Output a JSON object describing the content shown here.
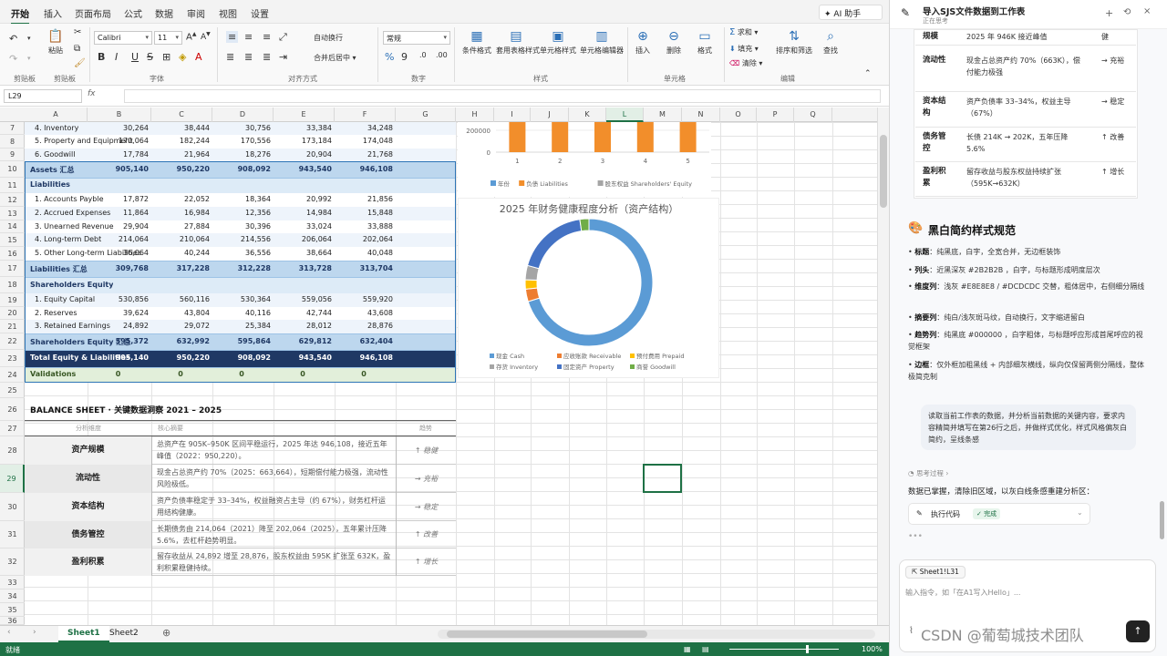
{
  "ribbon": {
    "tabs": [
      "开始",
      "插入",
      "页面布局",
      "公式",
      "数据",
      "审阅",
      "视图",
      "设置"
    ],
    "ai_button": "AI 助手",
    "groups": [
      "剪贴板",
      "字体",
      "对齐方式",
      "数字",
      "样式",
      "单元格",
      "编辑"
    ],
    "clipboard": {
      "paste": "粘贴"
    },
    "font": {
      "name": "Calibri",
      "size": "11"
    },
    "align": {
      "wrap": "自动换行",
      "merge": "合并后居中"
    },
    "number": {
      "format": "常规"
    },
    "style": {
      "cond": "条件格式",
      "table": "套用表格样式",
      "cell_style": "单元格样式",
      "cell_edit": "单元格编辑器"
    },
    "cells": {
      "insert": "插入",
      "delete": "删除",
      "format": "格式"
    },
    "edit": {
      "sum": "求和",
      "fill": "填充",
      "clear": "清除",
      "sort": "排序和筛选",
      "find": "查找"
    }
  },
  "formula_bar": {
    "name_box": "L29",
    "fx": "fx",
    "value": ""
  },
  "columns": [
    "A",
    "B",
    "C",
    "D",
    "E",
    "F",
    "G",
    "H",
    "I",
    "J",
    "K",
    "L",
    "M",
    "N",
    "O",
    "P",
    "Q"
  ],
  "active_column": "L",
  "active_row": 29,
  "rows": [
    {
      "r": 7,
      "label": "4. Inventory",
      "v": [
        "30,264",
        "38,444",
        "30,756",
        "33,384",
        "34,248"
      ],
      "style": "item"
    },
    {
      "r": 8,
      "label": "5. Property and Equipment",
      "v": [
        "170,064",
        "182,244",
        "170,556",
        "173,184",
        "174,048"
      ],
      "style": "item"
    },
    {
      "r": 9,
      "label": "6. Goodwill",
      "v": [
        "17,784",
        "21,964",
        "18,276",
        "20,904",
        "21,768"
      ],
      "style": "item"
    },
    {
      "r": 10,
      "label": "Assets 汇总",
      "v": [
        "905,140",
        "950,220",
        "908,092",
        "943,540",
        "946,108"
      ],
      "style": "subtotal"
    },
    {
      "r": 11,
      "label": "Liabilities",
      "v": [
        "",
        "",
        "",
        "",
        ""
      ],
      "style": "section"
    },
    {
      "r": 12,
      "label": "1. Accounts Payble",
      "v": [
        "17,872",
        "22,052",
        "18,364",
        "20,992",
        "21,856"
      ],
      "style": "item"
    },
    {
      "r": 13,
      "label": "2. Accrued Expenses",
      "v": [
        "11,864",
        "16,984",
        "12,356",
        "14,984",
        "15,848"
      ],
      "style": "item"
    },
    {
      "r": 14,
      "label": "3. Unearned Revenue",
      "v": [
        "29,904",
        "27,884",
        "30,396",
        "33,024",
        "33,888"
      ],
      "style": "item"
    },
    {
      "r": 15,
      "label": "4. Long-term Debt",
      "v": [
        "214,064",
        "210,064",
        "214,556",
        "206,064",
        "202,064"
      ],
      "style": "item"
    },
    {
      "r": 16,
      "label": "5. Other Long-term Liabilities",
      "v": [
        "36,064",
        "40,244",
        "36,556",
        "38,664",
        "40,048"
      ],
      "style": "item"
    },
    {
      "r": 17,
      "label": "Liabilities 汇总",
      "v": [
        "309,768",
        "317,228",
        "312,228",
        "313,728",
        "313,704"
      ],
      "style": "subtotal"
    },
    {
      "r": 18,
      "label": "Shareholders Equity",
      "v": [
        "",
        "",
        "",
        "",
        ""
      ],
      "style": "section"
    },
    {
      "r": 19,
      "label": "1. Equity Capital",
      "v": [
        "530,856",
        "560,116",
        "530,364",
        "559,056",
        "559,920"
      ],
      "style": "item"
    },
    {
      "r": 20,
      "label": "2. Reserves",
      "v": [
        "39,624",
        "43,804",
        "40,116",
        "42,744",
        "43,608"
      ],
      "style": "item"
    },
    {
      "r": 21,
      "label": "3. Retained Earnings",
      "v": [
        "24,892",
        "29,072",
        "25,384",
        "28,012",
        "28,876"
      ],
      "style": "item"
    },
    {
      "r": 22,
      "label": "Shareholders Equity 汇总",
      "v": [
        "595,372",
        "632,992",
        "595,864",
        "629,812",
        "632,404"
      ],
      "style": "subtotal"
    },
    {
      "r": 23,
      "label": "Total Equity & Liabilities",
      "v": [
        "905,140",
        "950,220",
        "908,092",
        "943,540",
        "946,108"
      ],
      "style": "total"
    },
    {
      "r": 24,
      "label": "Validations",
      "v": [
        "0",
        "0",
        "0",
        "0",
        "0"
      ],
      "style": "valid"
    }
  ],
  "insights": {
    "title": "BALANCE SHEET · 关键数据洞察   2021 – 2025",
    "headers": [
      "分析维度",
      "核心摘要",
      "趋势"
    ],
    "items": [
      {
        "r": 28,
        "dim": "资产规模",
        "text": "总资产在 905K–950K 区间平稳运行，2025 年达 946,108，接近五年峰值（2022：950,220）。",
        "trend": "↑ 稳健"
      },
      {
        "r": 29,
        "dim": "流动性",
        "text": "现金占总资产约 70%（2025：663,664），短期偿付能力极强，流动性风险极低。",
        "trend": "→ 充裕"
      },
      {
        "r": 30,
        "dim": "资本结构",
        "text": "资产负债率稳定于 33–34%，权益融资占主导（约 67%），财务杠杆运用结构健康。",
        "trend": "→ 稳定"
      },
      {
        "r": 31,
        "dim": "债务管控",
        "text": "长期债务由 214,064（2021）降至 202,064（2025），五年累计压降 5.6%，去杠杆趋势明显。",
        "trend": "↑ 改善"
      },
      {
        "r": 32,
        "dim": "盈利积累",
        "text": "留存收益从 24,892 增至 28,876，股东权益由 595K 扩张至 632K，盈利积累稳健持续。",
        "trend": "↑ 增长"
      }
    ]
  },
  "chart_data": [
    {
      "type": "bar",
      "categories": [
        "1",
        "2",
        "3",
        "4",
        "5"
      ],
      "series": [
        {
          "name": "负债 Liabilities",
          "values": [
            309768,
            317228,
            312228,
            313728,
            313704
          ]
        }
      ],
      "legend": [
        "年份",
        "负债 Liabilities",
        "股东权益 Shareholders' Equity"
      ],
      "yticks": [
        "200000",
        "0"
      ],
      "ylim": [
        0,
        320000
      ],
      "legend_position": "bottom"
    },
    {
      "type": "pie",
      "title": "2025 年财务健康程度分析（资产结构）",
      "labels": [
        "现金 Cash",
        "应收账款 Receivable",
        "预付费用 Prepaid",
        "存货 Inventory",
        "固定资产 Property",
        "商誉 Goodwill"
      ],
      "values": [
        663664,
        30000,
        22380,
        34248,
        174048,
        21768
      ],
      "colors": [
        "#5b9bd5",
        "#ed7d31",
        "#ffc000",
        "#a5a5a5",
        "#4472c4",
        "#70ad47"
      ],
      "legend_position": "bottom"
    }
  ],
  "sheets": [
    "Sheet1",
    "Sheet2"
  ],
  "active_sheet": "Sheet1",
  "status": {
    "left": "就绪",
    "zoom": "100%"
  },
  "panel": {
    "title": "导入SJS文件数据到工作表",
    "subtitle": "正在思考",
    "table": [
      {
        "dim": "规模",
        "text": "2025 年 946K 接近峰值",
        "trend": "健"
      },
      {
        "dim": "流动性",
        "text": "现金占总资产约 70%（663K），偿付能力极强",
        "trend": "→ 充裕"
      },
      {
        "dim": "资本结构",
        "text": "资产负债率 33–34%，权益主导（67%）",
        "trend": "→ 稳定"
      },
      {
        "dim": "债务管控",
        "text": "长债 214K → 202K，五年压降 5.6%",
        "trend": "↑ 改善"
      },
      {
        "dim": "盈利积累",
        "text": "留存收益与股东权益持续扩张（595K→632K）",
        "trend": "↑ 增长"
      }
    ],
    "section_title": "黑白简约样式规范",
    "rules": [
      {
        "k": "标题",
        "v": "：纯黑底，白字，全宽合并，无边框装饰"
      },
      {
        "k": "列头",
        "v": "：近黑深灰 #2B2B2B ，白字，与标题形成明度层次"
      },
      {
        "k": "维度列",
        "v": "：浅灰 #E8E8E8 / #DCDCDC 交替，粗体居中，右侧细分隔线"
      },
      {
        "k": "摘要列",
        "v": "：纯白/浅灰斑马纹，自动换行，文字缩进留白"
      },
      {
        "k": "趋势列",
        "v": "：纯黑底 #000000 ，白字粗体，与标题呼应形成首尾呼应的视觉框架"
      },
      {
        "k": "边框",
        "v": "：仅外框加粗黑线 + 内部细灰横线，纵向仅保留两侧分隔线，整体极简克制"
      }
    ],
    "user_message": "读取当前工作表的数据，并分析当前数据的关键内容，要求内容精简并填写在第26行之后，并做样式优化，样式风格偏灰白简约，呈线条感",
    "thinking": "思考过程",
    "reply": "数据已掌握，清除旧区域，以灰白线条感重建分析区：",
    "run_code": "执行代码",
    "done": "完成",
    "chip": "Sheet1!L31",
    "placeholder": "输入指令，如「在A1写入Hello」..."
  },
  "watermark": "CSDN @葡萄城技术团队"
}
